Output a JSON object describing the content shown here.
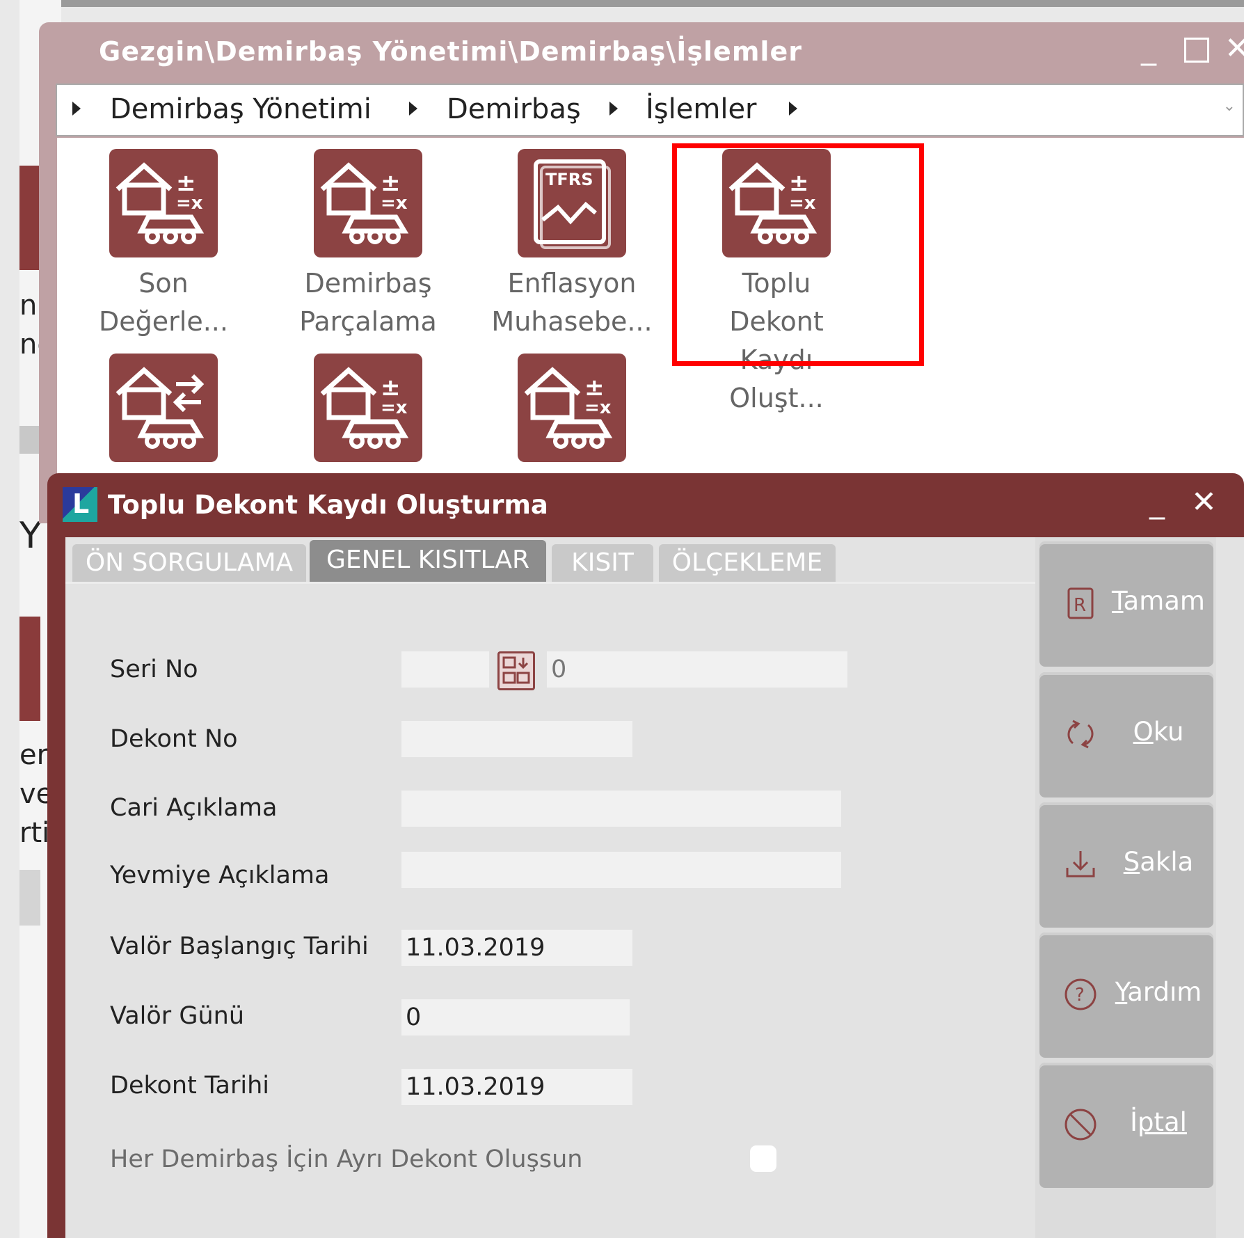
{
  "navigator": {
    "title": "Gezgin\\Demirbaş Yönetimi\\Demirbaş\\İşlemler",
    "breadcrumb": [
      "Demirbaş Yönetimi",
      "Demirbaş",
      "İşlemler"
    ],
    "tiles": [
      {
        "line1": "Son",
        "line2": "Değerle...",
        "icon": "asset-calc-icon"
      },
      {
        "line1": "Demirbaş",
        "line2": "Parçalama",
        "icon": "asset-calc-icon"
      },
      {
        "line1": "Enflasyon",
        "line2": "Muhasebe...",
        "icon": "tfrs-report-icon",
        "icon_text": "TFRS"
      },
      {
        "line1": "Toplu Dekont",
        "line2": "Kaydı Oluşt...",
        "icon": "asset-calc-icon"
      }
    ],
    "tiles_row2": [
      {
        "icon": "asset-transfer-icon"
      },
      {
        "icon": "asset-calc-icon"
      },
      {
        "icon": "asset-calc-icon"
      }
    ]
  },
  "background_fragments": [
    "ni",
    "ne",
    "Y",
    "er",
    "ve",
    "rti"
  ],
  "dialog": {
    "logo_letter": "L",
    "title": "Toplu Dekont Kaydı Oluşturma",
    "tabs": [
      "ÖN SORGULAMA",
      "GENEL KISITLAR",
      "KISIT",
      "ÖLÇEKLEME"
    ],
    "active_tab": "GENEL KISITLAR",
    "fields": {
      "seri_no": {
        "label": "Seri No",
        "value": "",
        "number": "0"
      },
      "dekont_no": {
        "label": "Dekont No",
        "value": ""
      },
      "cari_aciklama": {
        "label": "Cari Açıklama",
        "value": ""
      },
      "yevmiye_aciklama": {
        "label": "Yevmiye Açıklama",
        "value": ""
      },
      "valor_baslangic": {
        "label": "Valör Başlangıç Tarihi",
        "value": "11.03.2019"
      },
      "valor_gunu": {
        "label": "Valör Günü",
        "value": "0"
      },
      "dekont_tarihi": {
        "label": "Dekont Tarihi",
        "value": "11.03.2019"
      }
    },
    "checkbox": {
      "label": "Her Demirbaş İçin Ayrı Dekont Oluşsun",
      "checked": false
    },
    "buttons": [
      {
        "first": "T",
        "rest": "amam",
        "icon": "report-icon"
      },
      {
        "first": "O",
        "rest": "ku",
        "icon": "refresh-icon"
      },
      {
        "first": "S",
        "rest": "akla",
        "icon": "save-download-icon"
      },
      {
        "first": "Y",
        "rest": "ardım",
        "icon": "help-icon"
      },
      {
        "first": "İ",
        "rest": "ptal",
        "icon": "cancel-icon"
      }
    ]
  },
  "colors": {
    "brand": "#8c4343",
    "dialog_frame": "#7a3434",
    "navigator_frame": "#bfa1a4",
    "highlight": "#ff0000"
  }
}
